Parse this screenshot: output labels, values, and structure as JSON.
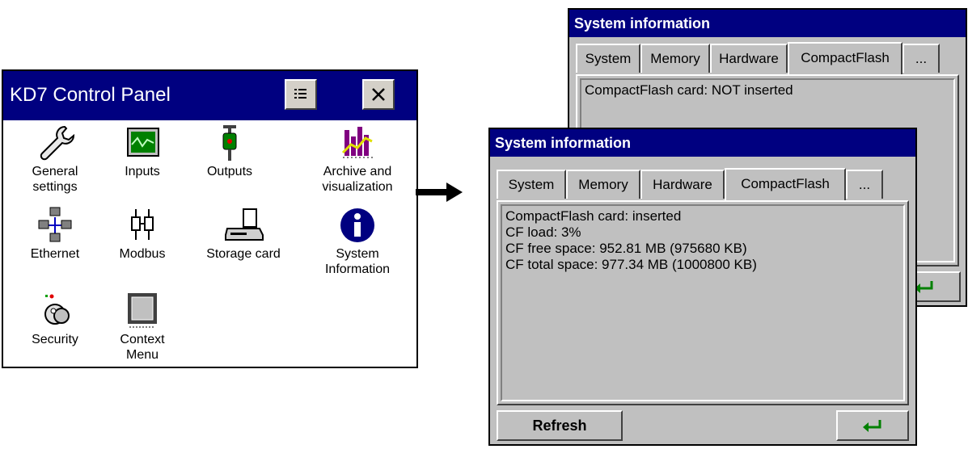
{
  "control_panel": {
    "title": "KD7 Control Panel",
    "items": [
      {
        "label": "General\nsettings",
        "icon": "wrench-icon"
      },
      {
        "label": "Inputs",
        "icon": "monitor-signal-icon"
      },
      {
        "label": "Outputs",
        "icon": "output-plug-icon"
      },
      {
        "label": "Archive and\nvisualization",
        "icon": "bar-chart-icon"
      },
      {
        "label": "Ethernet",
        "icon": "network-icon"
      },
      {
        "label": "Modbus",
        "icon": "modbus-plug-icon"
      },
      {
        "label": "Storage card",
        "icon": "card-reader-icon"
      },
      {
        "label": "System\nInformation",
        "icon": "info-icon"
      },
      {
        "label": "Security",
        "icon": "keys-icon"
      },
      {
        "label": "Context\nMenu",
        "icon": "context-menu-icon"
      }
    ]
  },
  "system_info_back": {
    "title": "System information",
    "tabs": [
      "System",
      "Memory",
      "Hardware",
      "CompactFlash",
      "..."
    ],
    "active_tab": "CompactFlash",
    "lines": [
      "CompactFlash card: NOT inserted"
    ]
  },
  "system_info_front": {
    "title": "System information",
    "tabs": [
      "System",
      "Memory",
      "Hardware",
      "CompactFlash",
      "..."
    ],
    "active_tab": "CompactFlash",
    "lines": [
      "CompactFlash card: inserted",
      "CF load: 3%",
      "CF free space: 952.81 MB (975680 KB)",
      "CF total space: 977.34 MB (1000800 KB)"
    ],
    "refresh_label": "Refresh"
  },
  "colors": {
    "title_bar": "#000080",
    "panel": "#c0c0c0",
    "enter_arrow": "#008000"
  }
}
